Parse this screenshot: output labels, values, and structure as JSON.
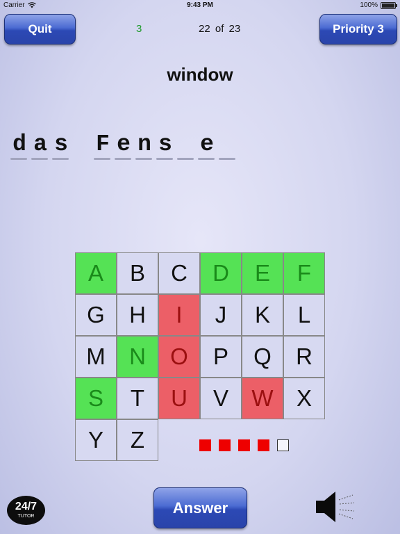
{
  "status_bar": {
    "carrier": "Carrier",
    "time": "9:43 PM",
    "battery": "100%"
  },
  "toolbar": {
    "quit_label": "Quit",
    "priority_label": "Priority 3",
    "score": "3",
    "progress": "22 of 23"
  },
  "prompt_word": "window",
  "answer_slots": [
    "d",
    "a",
    "s",
    " ",
    "F",
    "e",
    "n",
    "s",
    "",
    "e",
    ""
  ],
  "letter_grid": [
    {
      "letter": "A",
      "state": "correct"
    },
    {
      "letter": "B",
      "state": "normal"
    },
    {
      "letter": "C",
      "state": "normal"
    },
    {
      "letter": "D",
      "state": "correct"
    },
    {
      "letter": "E",
      "state": "correct"
    },
    {
      "letter": "F",
      "state": "correct"
    },
    {
      "letter": "G",
      "state": "normal"
    },
    {
      "letter": "H",
      "state": "normal"
    },
    {
      "letter": "I",
      "state": "wrong"
    },
    {
      "letter": "J",
      "state": "normal"
    },
    {
      "letter": "K",
      "state": "normal"
    },
    {
      "letter": "L",
      "state": "normal"
    },
    {
      "letter": "M",
      "state": "normal"
    },
    {
      "letter": "N",
      "state": "correct"
    },
    {
      "letter": "O",
      "state": "wrong"
    },
    {
      "letter": "P",
      "state": "normal"
    },
    {
      "letter": "Q",
      "state": "normal"
    },
    {
      "letter": "R",
      "state": "normal"
    },
    {
      "letter": "S",
      "state": "correct"
    },
    {
      "letter": "T",
      "state": "normal"
    },
    {
      "letter": "U",
      "state": "wrong"
    },
    {
      "letter": "V",
      "state": "normal"
    },
    {
      "letter": "W",
      "state": "wrong"
    },
    {
      "letter": "X",
      "state": "normal"
    },
    {
      "letter": "Y",
      "state": "normal"
    },
    {
      "letter": "Z",
      "state": "normal"
    }
  ],
  "attempts": {
    "used": 4,
    "total": 5
  },
  "answer_button_label": "Answer",
  "logo": {
    "big": "24/7",
    "small": "TUTOR"
  },
  "icons": {
    "wifi": "wifi-icon",
    "battery": "battery-icon",
    "speaker": "speaker-icon"
  },
  "colors": {
    "correct": "#55e255",
    "wrong": "#ec5f67",
    "tile": "#d7d9f1",
    "button": "#3a58c4",
    "attempt_used": "#ee0000"
  }
}
